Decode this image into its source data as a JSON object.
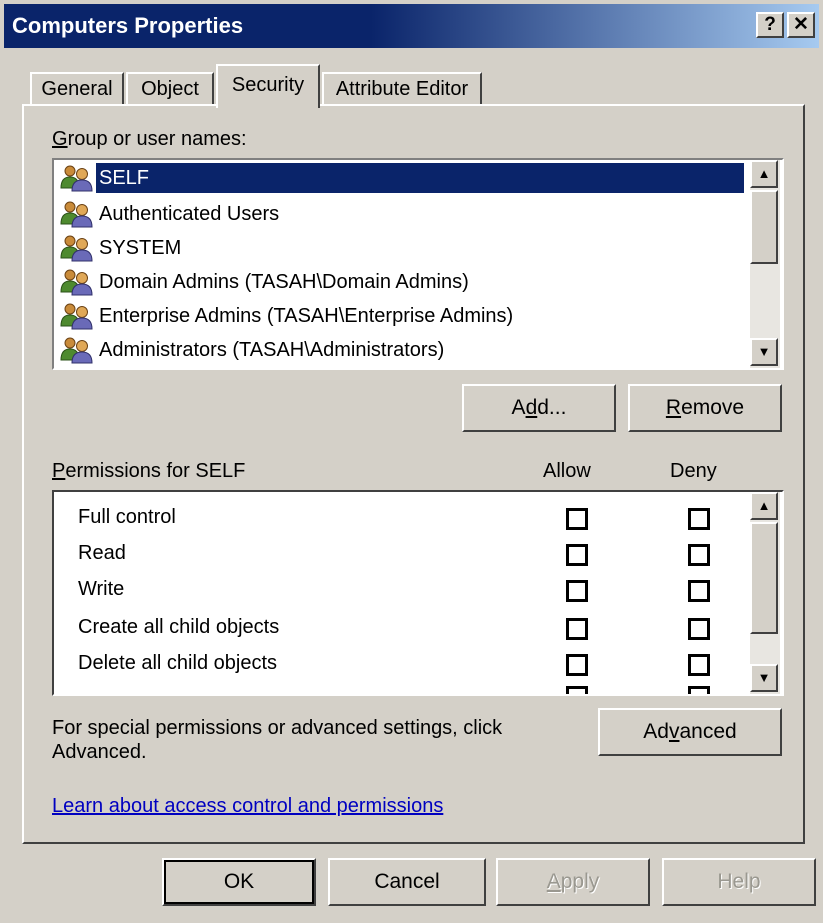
{
  "window": {
    "title": "Computers Properties",
    "help_button": "?",
    "close_button": "✕"
  },
  "tabs": [
    {
      "label": "General",
      "selected": false
    },
    {
      "label": "Object",
      "selected": false
    },
    {
      "label": "Security",
      "selected": true
    },
    {
      "label": "Attribute Editor",
      "selected": false
    }
  ],
  "groups": {
    "label_mnemonic": "G",
    "label_rest": "roup or user names:",
    "items": [
      {
        "name": "SELF",
        "icon": "users-icon",
        "selected": true
      },
      {
        "name": "Authenticated Users",
        "icon": "users-icon",
        "selected": false
      },
      {
        "name": "SYSTEM",
        "icon": "users-icon",
        "selected": false
      },
      {
        "name": "Domain Admins (TASAH\\Domain Admins)",
        "icon": "users-icon",
        "selected": false
      },
      {
        "name": "Enterprise Admins (TASAH\\Enterprise Admins)",
        "icon": "users-icon",
        "selected": false
      },
      {
        "name": "Administrators (TASAH\\Administrators)",
        "icon": "users-icon",
        "selected": false
      }
    ],
    "add_pre": "A",
    "add_mnemonic": "d",
    "add_post": "d...",
    "remove_mnemonic": "R",
    "remove_post": "emove"
  },
  "permissions": {
    "label_mnemonic": "P",
    "label_rest": "ermissions for SELF",
    "allow_header": "Allow",
    "deny_header": "Deny",
    "rows": [
      {
        "name": "Full control",
        "allow": false,
        "deny": false
      },
      {
        "name": "Read",
        "allow": false,
        "deny": false
      },
      {
        "name": "Write",
        "allow": false,
        "deny": false
      },
      {
        "name": "Create all child objects",
        "allow": false,
        "deny": false
      },
      {
        "name": "Delete all child objects",
        "allow": false,
        "deny": false
      }
    ]
  },
  "advanced": {
    "line1": "For special permissions or advanced settings, click",
    "line2": "Advanced.",
    "button_pre": "Ad",
    "button_mnemonic": "v",
    "button_post": "anced"
  },
  "link": {
    "text": "Learn about access control and permissions"
  },
  "footer": {
    "ok": "OK",
    "cancel": "Cancel",
    "apply_mnemonic": "A",
    "apply_post": "pply",
    "help": "Help"
  },
  "colors": {
    "titlebar": "#0a246a",
    "selection": "#0a246a",
    "face": "#d4d0c8",
    "link": "#0000c0"
  }
}
